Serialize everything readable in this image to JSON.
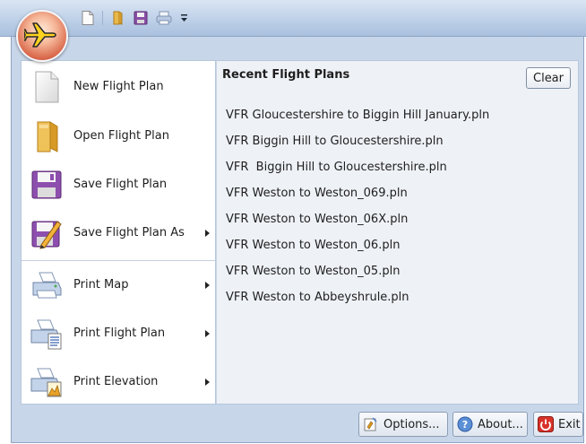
{
  "app": {
    "orb_icon": "airplane-icon"
  },
  "quick_access": [
    {
      "icon": "new-document-icon"
    },
    {
      "icon": "open-folder-icon"
    },
    {
      "icon": "save-disk-icon"
    },
    {
      "icon": "print-icon"
    }
  ],
  "menu": {
    "items": [
      {
        "label": "New Flight Plan",
        "icon": "new-document-icon",
        "has_submenu": false
      },
      {
        "label": "Open Flight Plan",
        "icon": "open-folder-icon",
        "has_submenu": false
      },
      {
        "label": "Save Flight Plan",
        "icon": "save-disk-icon",
        "has_submenu": false
      },
      {
        "label": "Save Flight Plan As",
        "icon": "save-as-icon",
        "has_submenu": true
      },
      {
        "label": "Print Map",
        "icon": "printer-icon",
        "has_submenu": true
      },
      {
        "label": "Print Flight Plan",
        "icon": "printer-plan-icon",
        "has_submenu": true
      },
      {
        "label": "Print Elevation",
        "icon": "printer-elevation-icon",
        "has_submenu": true
      }
    ]
  },
  "recent": {
    "title": "Recent Flight Plans",
    "clear_label": "Clear",
    "files": [
      "VFR Gloucestershire to Biggin Hill January.pln",
      "VFR Biggin Hill to Gloucestershire.pln",
      "VFR  Biggin Hill to Gloucestershire.pln",
      "VFR Weston to Weston_069.pln",
      "VFR Weston to Weston_06X.pln",
      "VFR Weston to Weston_06.pln",
      "VFR Weston to Weston_05.pln",
      "VFR Weston to Abbeyshrule.pln"
    ]
  },
  "bottom": {
    "options_label": "Options...",
    "about_label": "About...",
    "exit_label": "Exit"
  }
}
